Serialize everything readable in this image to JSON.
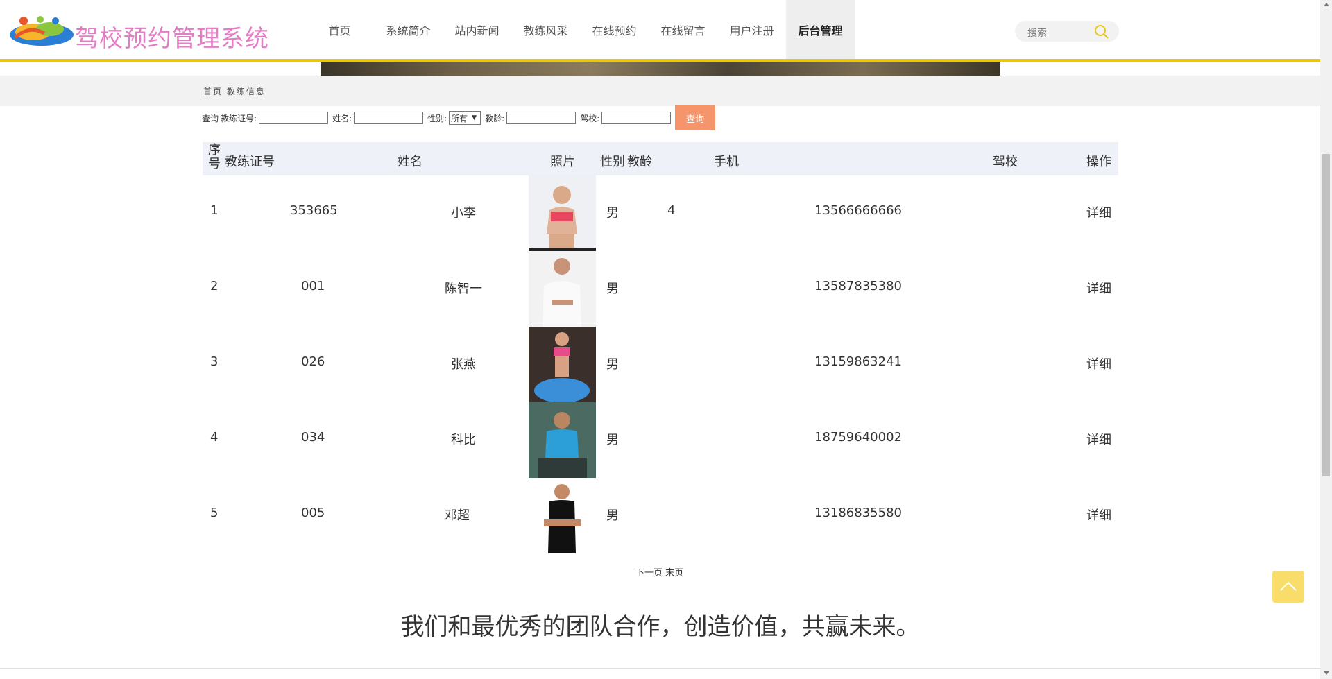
{
  "header": {
    "site_title": "驾校预约管理系统",
    "logo_icon": "colorful-people-logo",
    "nav": [
      {
        "label": "首页",
        "active": false
      },
      {
        "label": "系统简介",
        "active": false
      },
      {
        "label": "站内新闻",
        "active": false
      },
      {
        "label": "教练风采",
        "active": false
      },
      {
        "label": "在线预约",
        "active": false
      },
      {
        "label": "在线留言",
        "active": false
      },
      {
        "label": "用户注册",
        "active": false
      },
      {
        "label": "后台管理",
        "active": true
      }
    ],
    "search_placeholder": "搜索",
    "accent_color": "#e6c619",
    "title_color": "#e57cc6"
  },
  "breadcrumb": "首页 教练信息",
  "query": {
    "prefix": "查询",
    "cert_label": "教练证号:",
    "name_label": "姓名:",
    "gender_label": "性别:",
    "gender_selected": "所有",
    "age_label": "教龄:",
    "school_label": "驾校:",
    "submit_label": "查询",
    "submit_color": "#f5956c"
  },
  "table": {
    "headers": {
      "index": "序号",
      "cert": "教练证号",
      "name": "姓名",
      "photo": "照片",
      "gender": "性别",
      "age": "教龄",
      "phone": "手机",
      "school": "驾校",
      "action": "操作"
    },
    "rows": [
      {
        "index": "1",
        "cert": "353665",
        "name": "小李",
        "gender": "男",
        "age": "4",
        "phone": "13566666666",
        "school": "",
        "action": "详细"
      },
      {
        "index": "2",
        "cert": "001",
        "name": "陈智一",
        "gender": "男",
        "age": "",
        "phone": "13587835380",
        "school": "",
        "action": "详细"
      },
      {
        "index": "3",
        "cert": "026",
        "name": "张燕",
        "gender": "男",
        "age": "",
        "phone": "13159863241",
        "school": "",
        "action": "详细"
      },
      {
        "index": "4",
        "cert": "034",
        "name": "科比",
        "gender": "男",
        "age": "",
        "phone": "18759640002",
        "school": "",
        "action": "详细"
      },
      {
        "index": "5",
        "cert": "005",
        "name": "邓超",
        "gender": "男",
        "age": "",
        "phone": "13186835580",
        "school": "",
        "action": "详细"
      }
    ]
  },
  "pager": {
    "next": "下一页",
    "last": "末页"
  },
  "slogan": "我们和最优秀的团队合作，创造价值，共赢未来。",
  "back_to_top_icon": "chevron-up-icon"
}
